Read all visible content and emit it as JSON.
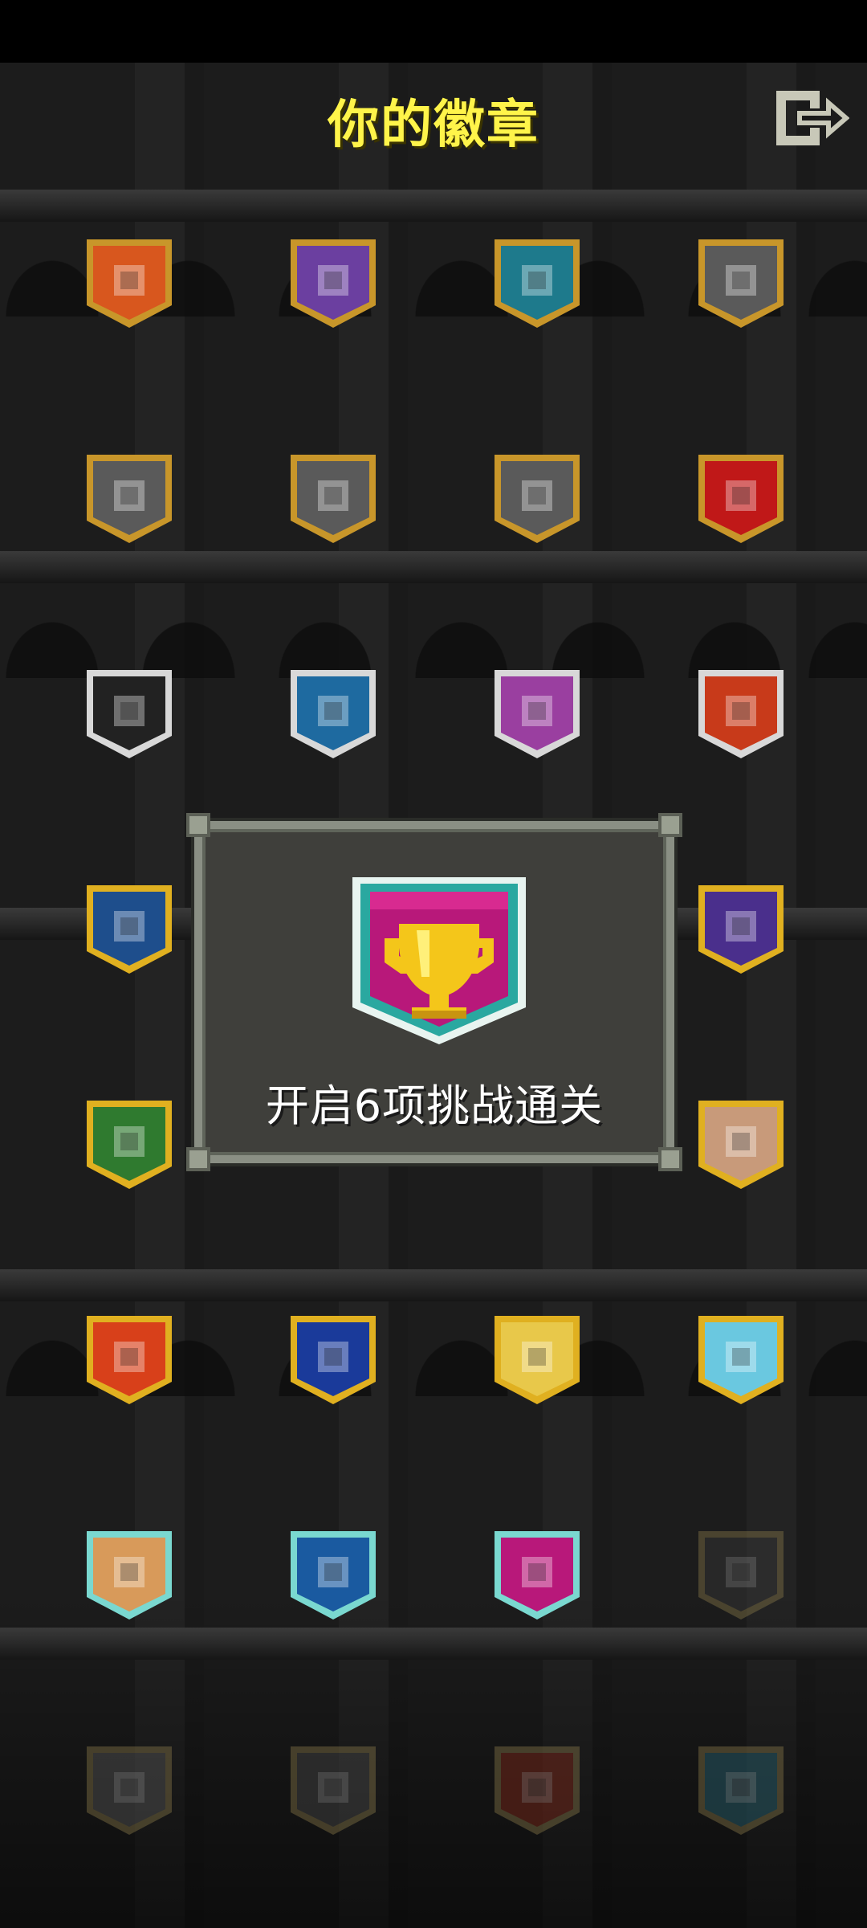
{
  "header": {
    "title": "你的徽章",
    "exit_icon": "exit-door-icon"
  },
  "badges": [
    {
      "name": "warrior-portrait-badge",
      "color": "#d8571e"
    },
    {
      "name": "mage-portrait-badge",
      "color": "#6b3fa0"
    },
    {
      "name": "rogue-portrait-badge",
      "color": "#1e7a8c"
    },
    {
      "name": "fire-badge",
      "color": "#5a5a5a"
    },
    {
      "name": "potion-badge",
      "color": "#5a5a5a"
    },
    {
      "name": "skull-green-badge",
      "color": "#5a5a5a"
    },
    {
      "name": "red-figure-badge",
      "color": "#5a5a5a"
    },
    {
      "name": "red-demon-badge",
      "color": "#c01818"
    },
    {
      "name": "skull-badge",
      "color": "#222222"
    },
    {
      "name": "sword-badge",
      "color": "#1e6aa0"
    },
    {
      "name": "gold-badge",
      "color": "#9a3fa0"
    },
    {
      "name": "plus-red-badge",
      "color": "#c83a1a"
    },
    {
      "name": "fish-badge",
      "color": "#1e4e8c"
    },
    {
      "name": "arrow-badge",
      "color": "#4a2f8c"
    },
    {
      "name": "pawn-badge",
      "color": "#2f7a2f"
    },
    {
      "name": "bag-badge",
      "color": "#c89a7a"
    },
    {
      "name": "plus-orange-badge",
      "color": "#d8401a"
    },
    {
      "name": "gem-blue-badge",
      "color": "#1a3a9a"
    },
    {
      "name": "chest-badge",
      "color": "#e8c84a"
    },
    {
      "name": "cloud-badge",
      "color": "#6ac8e0"
    },
    {
      "name": "door-badge",
      "color": "#d89a5a"
    },
    {
      "name": "gem-teal-badge",
      "color": "#1a5aa0"
    },
    {
      "name": "trophy-badge",
      "color": "#b8187a"
    },
    {
      "name": "locked-wheel-badge",
      "color": "#3a3a3a",
      "locked": true
    },
    {
      "name": "locked-bird-badge",
      "color": "#5a5a5a",
      "locked": true
    },
    {
      "name": "locked-tablet-badge",
      "color": "#4a4a4a",
      "locked": true
    },
    {
      "name": "locked-plus-badge",
      "color": "#8a2a1a",
      "locked": true
    },
    {
      "name": "locked-chest-badge",
      "color": "#2a6a7a",
      "locked": true
    }
  ],
  "modal": {
    "icon": "trophy-icon",
    "text": "开启6项挑战通关"
  }
}
